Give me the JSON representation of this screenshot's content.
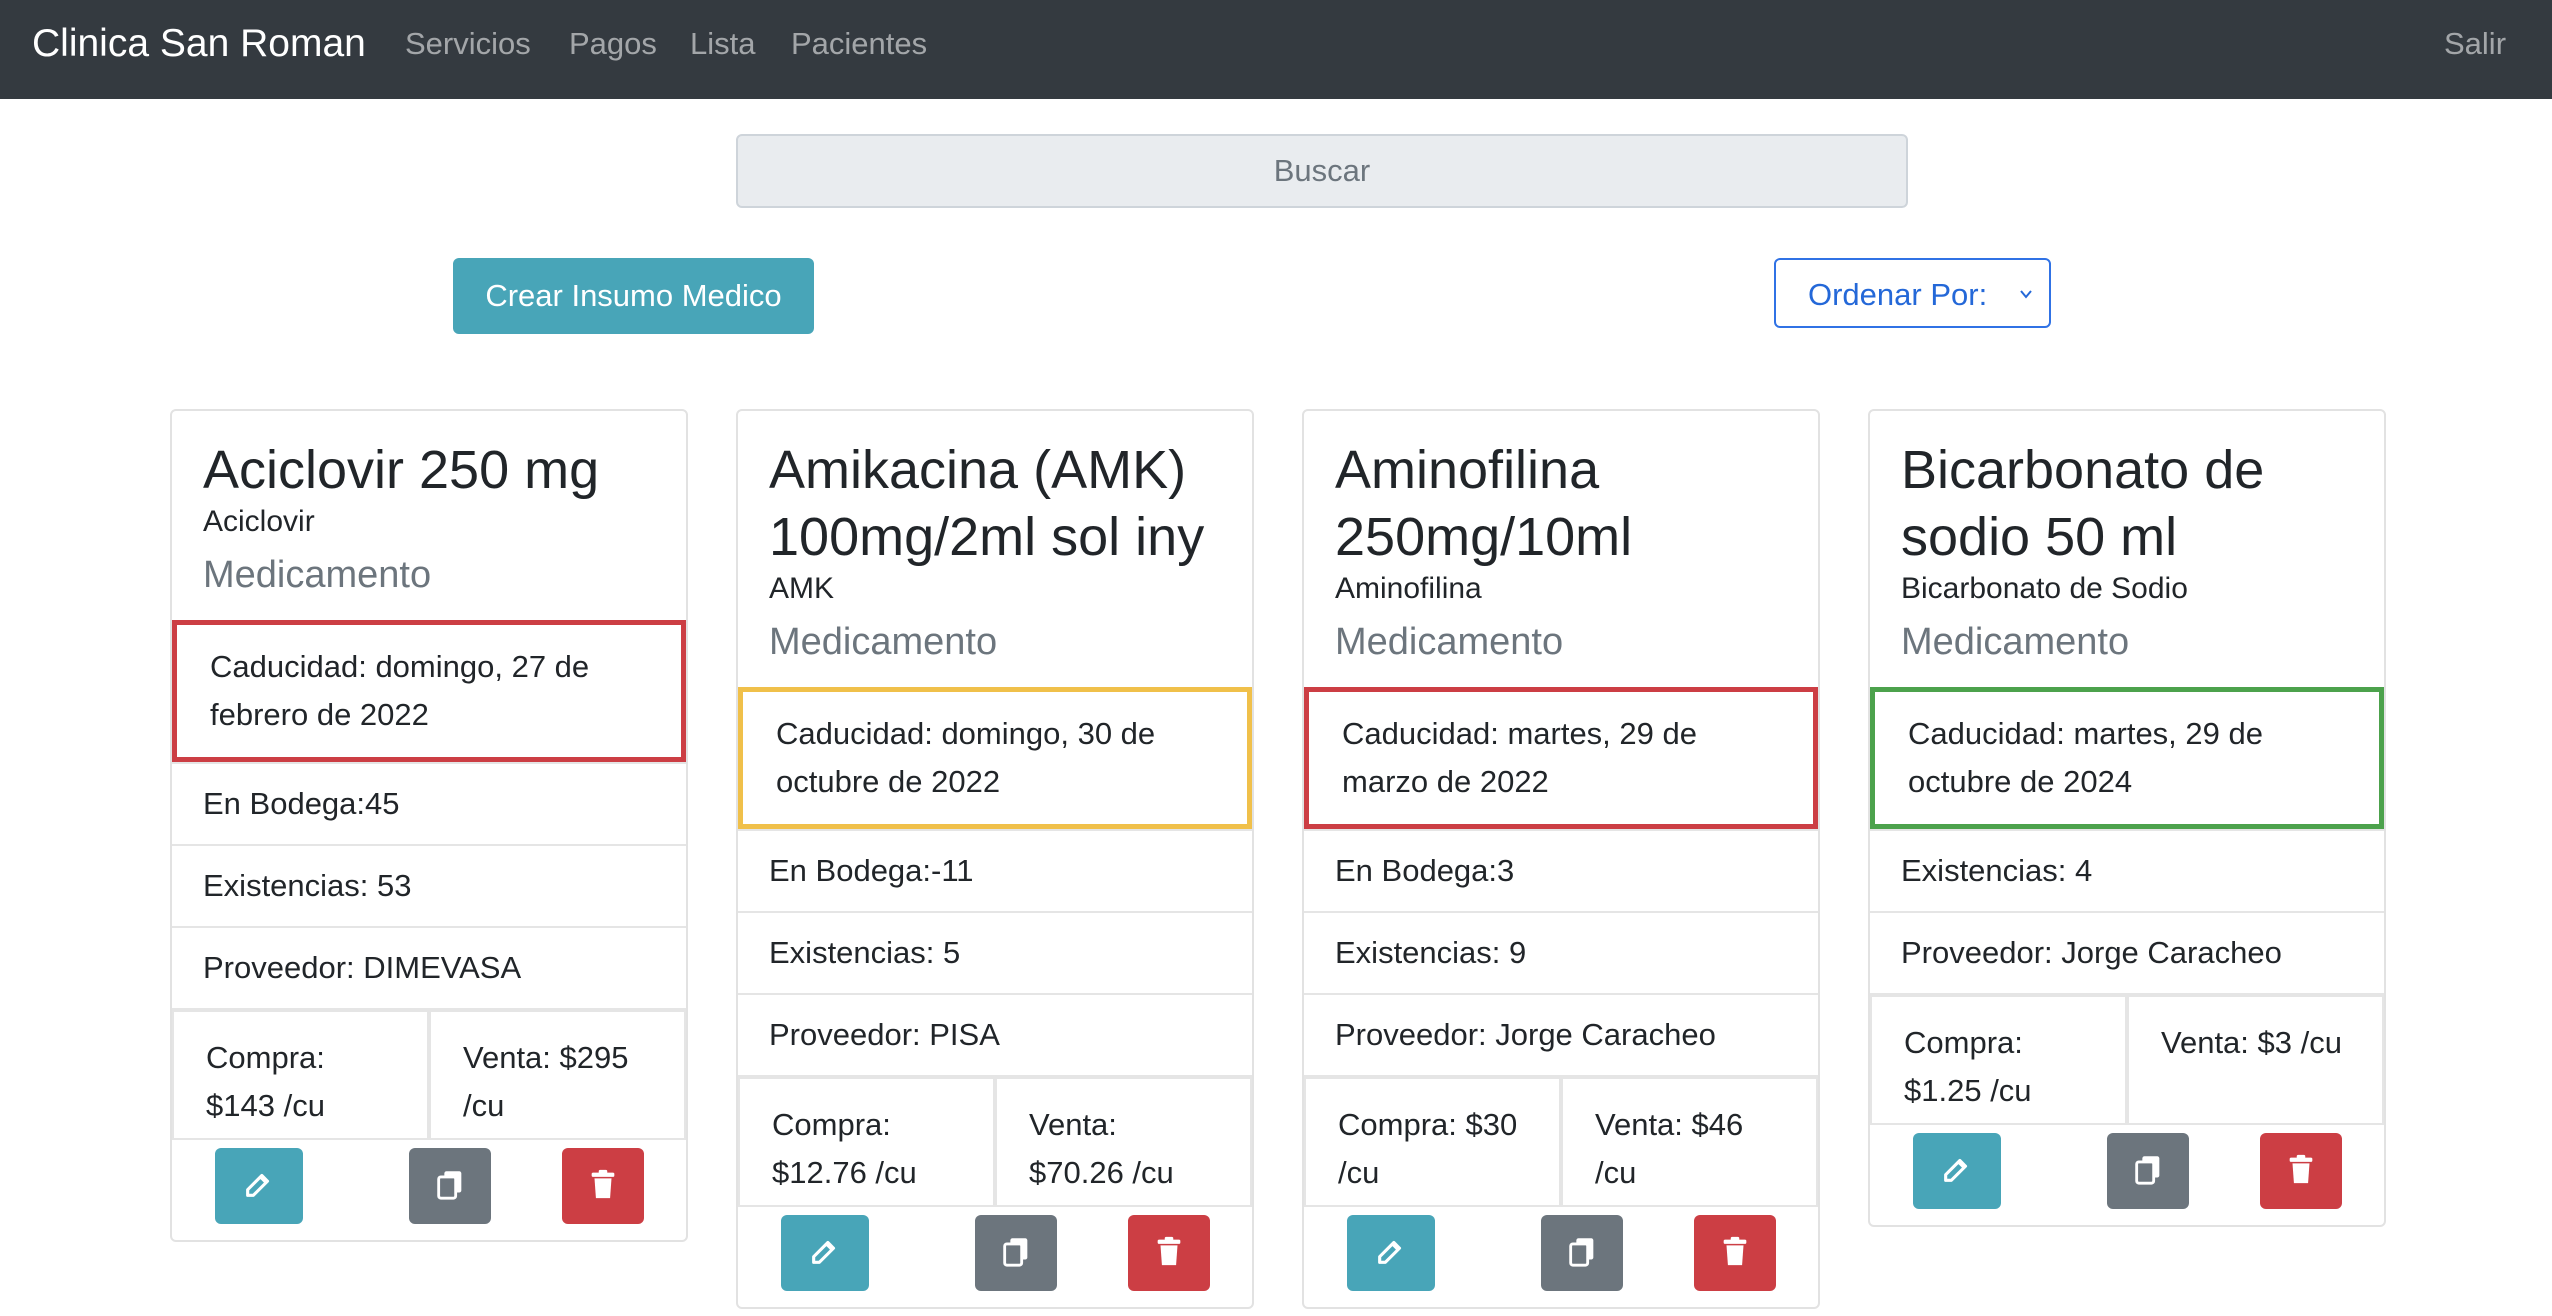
{
  "nav": {
    "brand": "Clinica San Roman",
    "links": [
      "Servicios",
      "Pagos",
      "Lista",
      "Pacientes"
    ],
    "logout": "Salir"
  },
  "search": {
    "placeholder": "Buscar"
  },
  "toolbar": {
    "create_label": "Crear Insumo Medico",
    "sort_label": "Ordenar Por:"
  },
  "colors": {
    "navbar": "#343a40",
    "info": "#48a5b8",
    "secondary": "#6c757d",
    "danger": "#cc3e44",
    "warning": "#f0c04a",
    "success": "#4ca24c",
    "primary": "#2468d8"
  },
  "icons": {
    "edit": "pencil-square-icon",
    "copy": "copy-icon",
    "delete": "trash-icon",
    "sort": "chevron-down-icon"
  },
  "cards": [
    {
      "title": "Aciclovir 250 mg",
      "subtitle": "Aciclovir",
      "type": "Medicamento",
      "expiry": "Caducidad: domingo, 27 de febrero de 2022",
      "expiry_status": "expired",
      "bodega": "En Bodega:45",
      "existencias": "Existencias: 53",
      "proveedor": "Proveedor: DIMEVASA",
      "compra": "Compra: $143 /cu",
      "venta": "Venta: $295 /cu"
    },
    {
      "title": "Amikacina (AMK) 100mg/2ml sol iny",
      "subtitle": "AMK",
      "type": "Medicamento",
      "expiry": "Caducidad: domingo, 30 de octubre de 2022",
      "expiry_status": "warning",
      "bodega": "En Bodega:-11",
      "existencias": "Existencias: 5",
      "proveedor": "Proveedor: PISA",
      "compra": "Compra: $12.76 /cu",
      "venta": "Venta: $70.26 /cu"
    },
    {
      "title": "Aminofilina 250mg/10ml",
      "subtitle": "Aminofilina",
      "type": "Medicamento",
      "expiry": "Caducidad: martes, 29 de marzo de 2022",
      "expiry_status": "expired",
      "bodega": "En Bodega:3",
      "existencias": "Existencias: 9",
      "proveedor": "Proveedor: Jorge Caracheo",
      "compra": "Compra: $30 /cu",
      "venta": "Venta: $46 /cu"
    },
    {
      "title": "Bicarbonato de sodio 50 ml",
      "subtitle": "Bicarbonato de Sodio",
      "type": "Medicamento",
      "expiry": "Caducidad: martes, 29 de octubre de 2024",
      "expiry_status": "ok",
      "bodega": "",
      "existencias": "Existencias: 4",
      "proveedor": "Proveedor: Jorge Caracheo",
      "compra": "Compra: $1.25 /cu",
      "venta": "Venta: $3 /cu"
    }
  ]
}
